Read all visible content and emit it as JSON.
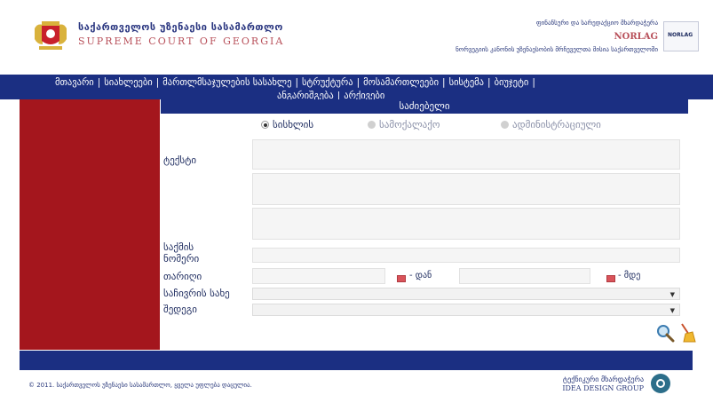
{
  "header": {
    "court_name_geo": "საქართველოს უზენაესი სასამართლო",
    "court_name_en": "SUPREME COURT OF GEORGIA",
    "partner_line1": "ფინანსური და სარედაქციო მხარდაჭერა",
    "partner_name": "NORLAG",
    "partner_line2": "ნორვეგიის კანონის უზენაესობის მრჩეველთა მისია საქართველოში",
    "partner_logo_text": "NORLAG"
  },
  "nav": {
    "items": [
      "მთავარი",
      "სიახლეები",
      "მართლმსაჯულების სასახლე",
      "სტრუქტურა",
      "მოსამართლეები",
      "სისტემა",
      "ბიუჯეტი",
      "ანგარიშგება",
      "არქივები"
    ],
    "separator": "|"
  },
  "search": {
    "title": "საძიებელი",
    "radios": [
      {
        "label": "სისხლის",
        "checked": true
      },
      {
        "label": "სამოქალაქო",
        "checked": false
      },
      {
        "label": "ადმინისტრაციული",
        "checked": false
      }
    ],
    "text_label": "ტექსტი",
    "case_number_label_1": "საქმის",
    "case_number_label_2": "ნომერი",
    "date_label": "თარიღი",
    "date_from_suffix": "- დან",
    "date_to_suffix": "- მდე",
    "claim_type_label": "საჩივრის სახე",
    "result_label": "შედეგი"
  },
  "footer": {
    "copyright": "© 2011. საქართველოს უზენაესი სასამართლო, ყველა უფლება დაცულია.",
    "designer_line1": "ტექნიკური მხარდაჭერა",
    "designer_line2": "IDEA DESIGN GROUP"
  },
  "colors": {
    "nav_blue": "#1b2f82",
    "sidebar_red": "#a4161d",
    "brand_red": "#b8505a"
  },
  "icons": {
    "emblem": "georgia-coat-of-arms-icon",
    "search": "search-icon",
    "clear": "broom-clear-icon",
    "calendar": "calendar-icon"
  }
}
